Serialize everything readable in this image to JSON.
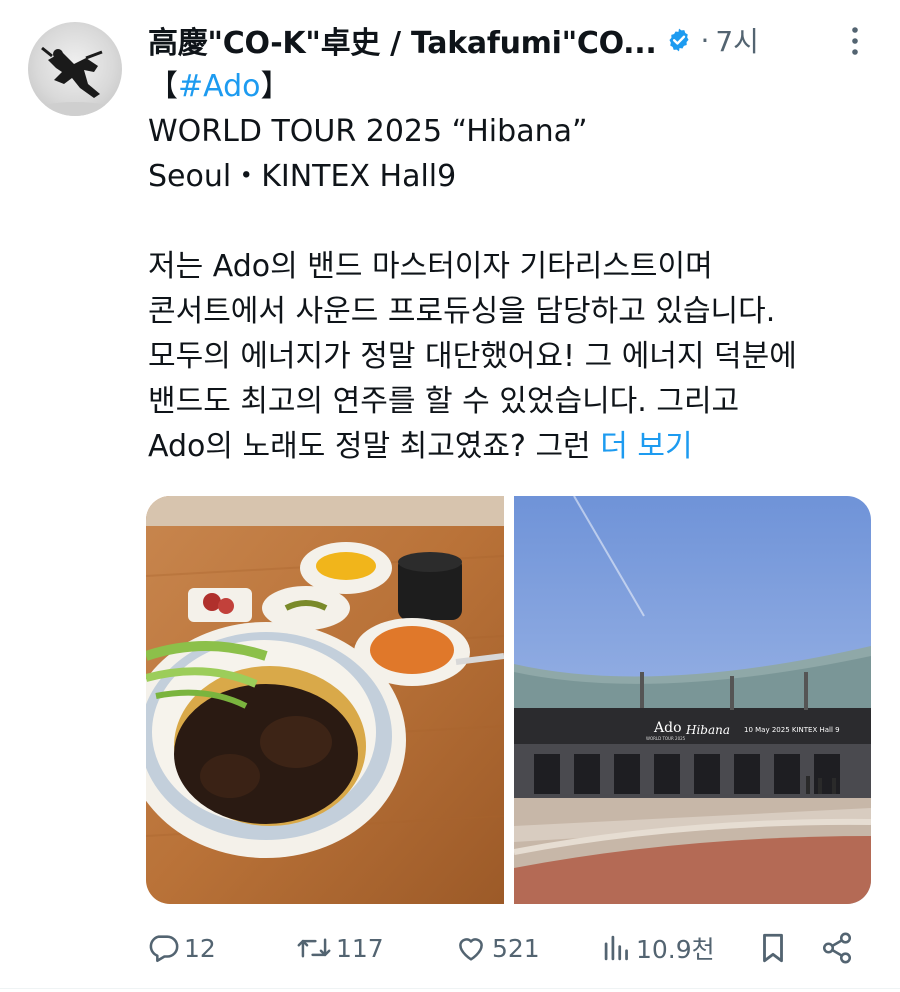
{
  "tweet": {
    "display_name": "高慶\"CO-K\"卓史 / Takafumi\"CO...",
    "separator": "·",
    "time": "7시",
    "text_lines": [
      {
        "parts": [
          {
            "t": "【",
            "link": false
          },
          {
            "t": "#Ado",
            "link": true
          },
          {
            "t": "】",
            "link": false
          }
        ]
      },
      {
        "parts": [
          {
            "t": "WORLD TOUR 2025 “Hibana”",
            "link": false
          }
        ]
      },
      {
        "parts": [
          {
            "t": "Seoul・KINTEX Hall9",
            "link": false
          }
        ]
      },
      {
        "parts": []
      },
      {
        "parts": [
          {
            "t": "저는 Ado의 밴드 마스터이자 기타리스트이며",
            "link": false
          }
        ]
      },
      {
        "parts": [
          {
            "t": "콘서트에서 사운드 프로듀싱을 담당하고 있습니다.",
            "link": false
          }
        ]
      },
      {
        "parts": [
          {
            "t": "모두의 에너지가 정말 대단했어요! 그 에너지 덕분에",
            "link": false
          }
        ]
      },
      {
        "parts": [
          {
            "t": "밴드도 최고의 연주를 할 수 있었습니다. 그리고",
            "link": false
          }
        ]
      },
      {
        "parts": [
          {
            "t": "Ado의 노래도 정말 최고였죠? 그런 ",
            "link": false
          },
          {
            "t": "더 보기",
            "link": true
          }
        ]
      }
    ],
    "media": {
      "sign_text": {
        "ado": "Ado",
        "tour": "WORLD TOUR 2025",
        "hibana": "Hibana",
        "date_venue": "10 May 2025 KINTEX Hall 9"
      }
    },
    "actions": {
      "reply_count": "12",
      "repost_count": "117",
      "like_count": "521",
      "view_count": "10.9천"
    },
    "icons": {
      "verified": "verified-badge-icon",
      "more": "more-vertical-icon",
      "reply": "reply-icon",
      "repost": "repost-icon",
      "like": "heart-icon",
      "views": "views-icon",
      "bookmark": "bookmark-icon",
      "share": "share-icon"
    },
    "colors": {
      "text": "#0f1419",
      "secondary": "#536471",
      "link": "#1d9bf0"
    }
  }
}
